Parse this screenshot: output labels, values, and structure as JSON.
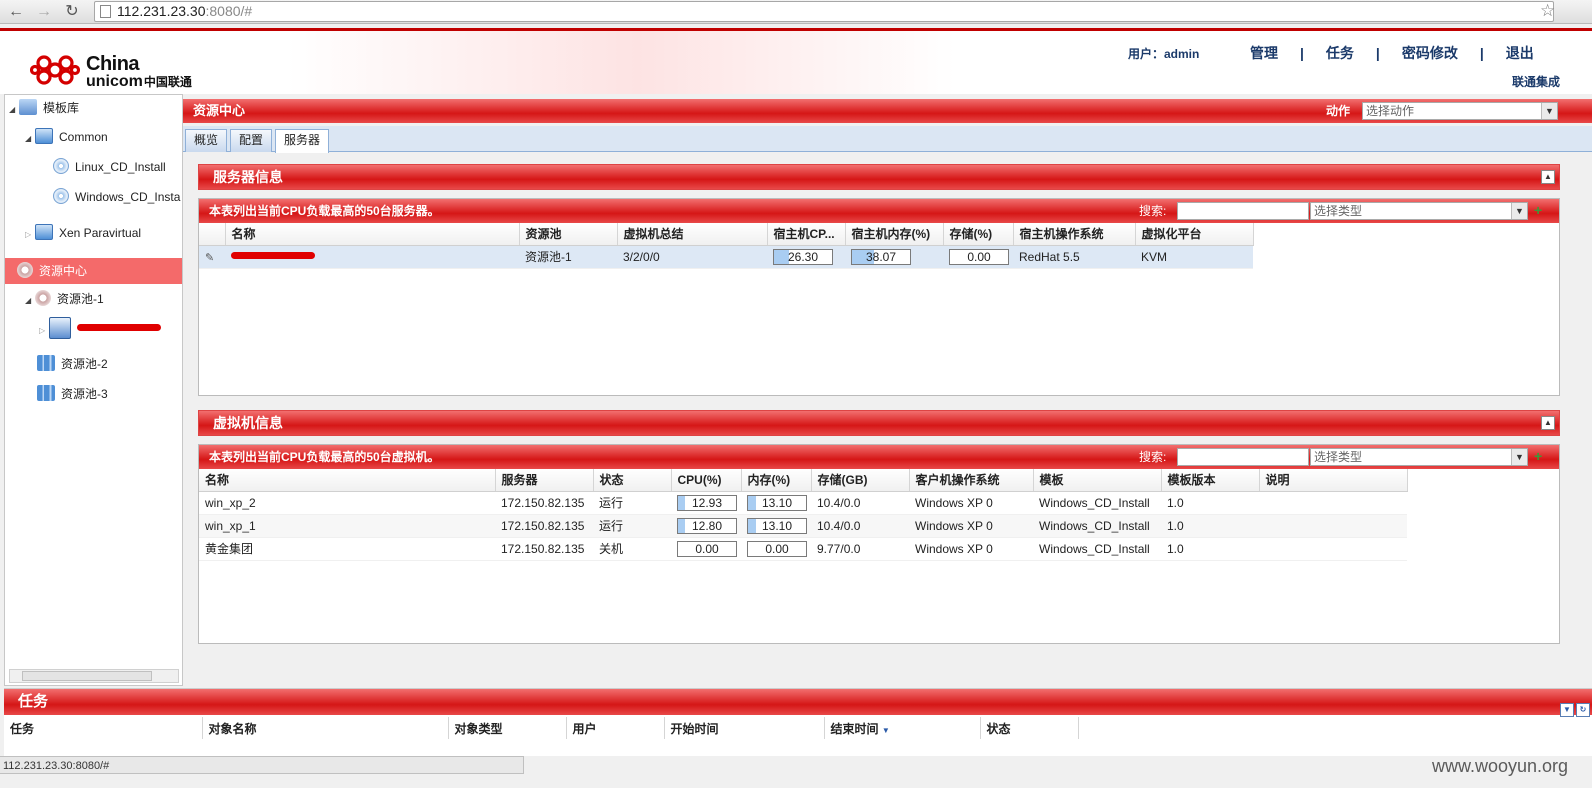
{
  "browser": {
    "url_host": "112.231.23.30",
    "url_rest": ":8080/#"
  },
  "header": {
    "logo_line1": "China",
    "logo_line2": "unicom",
    "logo_cn": "中国联通",
    "user_info": "用户：admin",
    "menu": [
      "管理",
      "任务",
      "密码修改",
      "退出"
    ],
    "brand_right": "联通集成"
  },
  "tree": {
    "items": [
      {
        "label": "模板库"
      },
      {
        "label": "Common"
      },
      {
        "label": "Linux_CD_Install"
      },
      {
        "label": "Windows_CD_Install"
      },
      {
        "label": "Xen Paravirtual"
      },
      {
        "label": "资源中心"
      },
      {
        "label": "资源池-1"
      },
      {
        "label": "资源池-2"
      },
      {
        "label": "资源池-3"
      }
    ]
  },
  "resource_center": {
    "title": "资源中心",
    "action_label": "动作",
    "action_placeholder": "选择动作",
    "tabs": [
      "概览",
      "配置",
      "服务器"
    ]
  },
  "server_section": {
    "title": "服务器信息",
    "caption": "本表列出当前CPU负载最高的50台服务器。",
    "search_label": "搜索:",
    "type_placeholder": "选择类型",
    "columns": [
      "名称",
      "资源池",
      "虚拟机总结",
      "宿主机CP...",
      "宿主机内存(%)",
      "存储(%)",
      "宿主机操作系统",
      "虚拟化平台"
    ],
    "rows": [
      {
        "pool": "资源池-1",
        "vm_summary": "3/2/0/0",
        "cpu": 26.3,
        "cpu_text": "26.30",
        "mem": 38.07,
        "mem_text": "38.07",
        "storage": 0.0,
        "storage_text": "0.00",
        "os": "RedHat 5.5",
        "platform": "KVM"
      }
    ]
  },
  "vm_section": {
    "title": "虚拟机信息",
    "caption": "本表列出当前CPU负载最高的50台虚拟机。",
    "search_label": "搜索:",
    "type_placeholder": "选择类型",
    "columns": [
      "名称",
      "服务器",
      "状态",
      "CPU(%)",
      "内存(%)",
      "存储(GB)",
      "客户机操作系统",
      "模板",
      "模板版本",
      "说明"
    ],
    "rows": [
      {
        "name": "win_xp_2",
        "server": "172.150.82.135",
        "state": "运行",
        "cpu": 12.93,
        "cpu_text": "12.93",
        "mem": 13.1,
        "mem_text": "13.10",
        "storage": "10.4/0.0",
        "os": "Windows XP 0",
        "template": "Windows_CD_Install",
        "version": "1.0"
      },
      {
        "name": "win_xp_1",
        "server": "172.150.82.135",
        "state": "运行",
        "cpu": 12.8,
        "cpu_text": "12.80",
        "mem": 13.1,
        "mem_text": "13.10",
        "storage": "10.4/0.0",
        "os": "Windows XP 0",
        "template": "Windows_CD_Install",
        "version": "1.0"
      },
      {
        "name": "黄金集团",
        "server": "172.150.82.135",
        "state": "关机",
        "cpu": 0.0,
        "cpu_text": "0.00",
        "mem": 0.0,
        "mem_text": "0.00",
        "storage": "9.77/0.0",
        "os": "Windows XP 0",
        "template": "Windows_CD_Install",
        "version": "1.0"
      }
    ]
  },
  "tasks": {
    "title": "任务",
    "columns": [
      "任务",
      "对象名称",
      "对象类型",
      "用户",
      "开始时间",
      "结束时间",
      "状态"
    ]
  },
  "statusbar": {
    "text": "112.231.23.30:8080/#"
  },
  "watermark": "www.wooyun.org",
  "colors": {
    "accent_red": "#d51616",
    "selected_tree": "#f46a6a",
    "bar_fill": "#a9cdf2"
  }
}
